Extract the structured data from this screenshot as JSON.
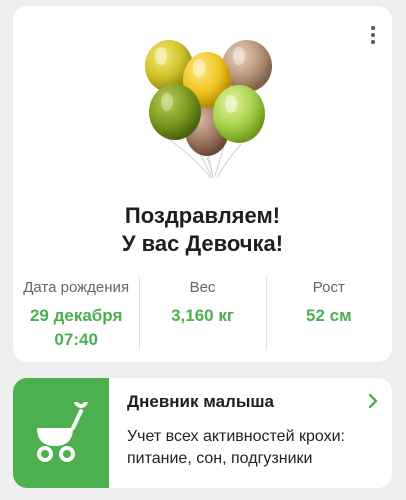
{
  "card": {
    "title_line1": "Поздравляем!",
    "title_line2": "У вас Девочка!",
    "menu_icon": "more-vertical-icon",
    "illustration": "balloons-illustration"
  },
  "stats": {
    "birth_label": "Дата рождения",
    "birth_date": "29 декабря",
    "birth_time": "07:40",
    "weight_label": "Вес",
    "weight_value": "3,160 кг",
    "height_label": "Рост",
    "height_value": "52 см"
  },
  "diary": {
    "title": "Дневник малыша",
    "description": "Учет всех активностей крохи: питание, сон, подгузники",
    "icon": "baby-stroller-icon",
    "chevron_icon": "chevron-right-icon"
  },
  "colors": {
    "accent": "#4caf50",
    "background": "#eeeeee",
    "card": "#ffffff"
  }
}
